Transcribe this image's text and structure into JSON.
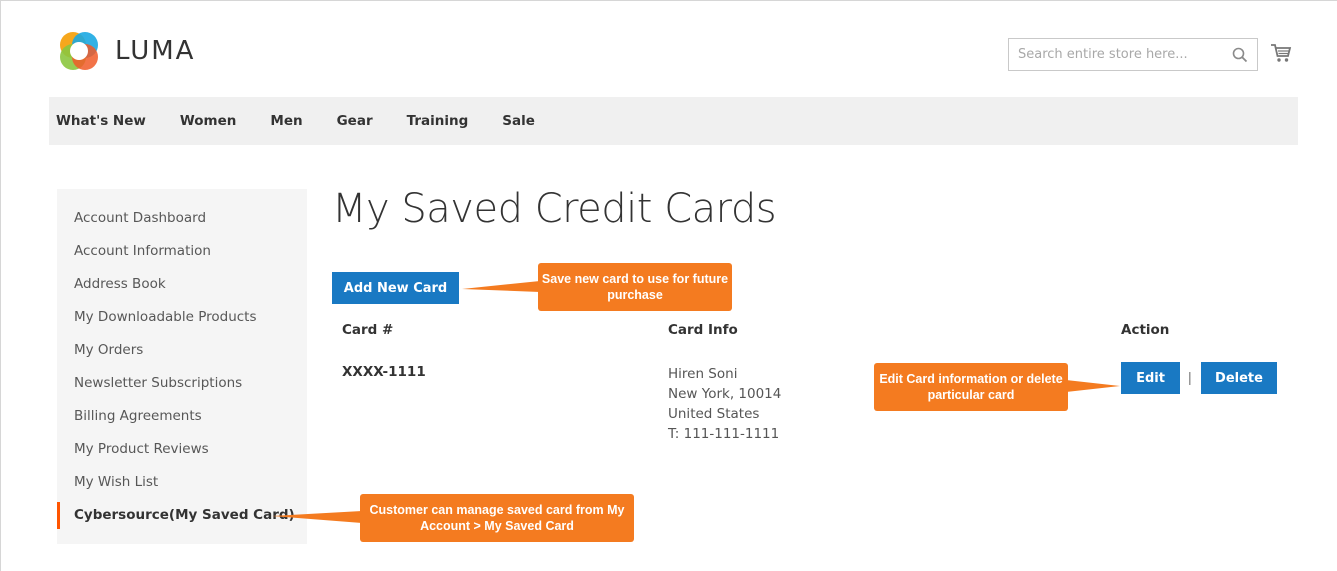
{
  "brand": {
    "name": "LUMA"
  },
  "search": {
    "placeholder": "Search entire store here..."
  },
  "nav": {
    "items": [
      "What's New",
      "Women",
      "Men",
      "Gear",
      "Training",
      "Sale"
    ]
  },
  "sidebar": {
    "items": [
      "Account Dashboard",
      "Account Information",
      "Address Book",
      "My Downloadable Products",
      "My Orders",
      "Newsletter Subscriptions",
      "Billing Agreements",
      "My Product Reviews",
      "My Wish List",
      "Cybersource(My Saved Card)"
    ],
    "active_index": 9
  },
  "main": {
    "title": "My Saved Credit Cards",
    "add_button": "Add New Card",
    "table": {
      "headers": {
        "card": "Card #",
        "info": "Card Info",
        "action": "Action"
      },
      "rows": [
        {
          "card": "XXXX-1111",
          "info": [
            "Hiren Soni",
            "New York, 10014",
            "United States",
            "T: 111-111-1111"
          ],
          "edit": "Edit",
          "separator": "|",
          "delete": "Delete"
        }
      ]
    }
  },
  "callouts": {
    "add": "Save new card to use for future purchase",
    "edit": "Edit Card information or delete particular card",
    "sidebar": "Customer can manage saved card from My Account > My Saved Card"
  },
  "colors": {
    "accent": "#1979c3",
    "callout": "#f47b20",
    "active_bar": "#ff5501",
    "nav_bg": "#f0f0f0",
    "sidebar_bg": "#f5f5f5"
  }
}
